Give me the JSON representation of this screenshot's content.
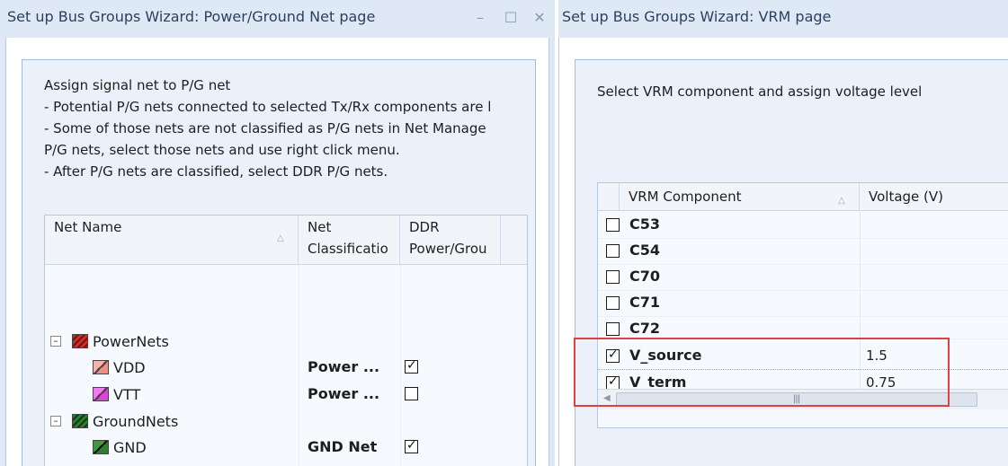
{
  "left_window": {
    "title": "Set up Bus Groups Wizard: Power/Ground Net page",
    "controls": {
      "minimize": "–",
      "maximize": "☐",
      "close": "✕"
    },
    "instructions": [
      "Assign signal net to P/G net",
      "- Potential P/G nets connected to selected Tx/Rx components are l",
      "- Some of those nets are not classified as P/G nets in Net Manage",
      "P/G nets, select those nets and use right click menu.",
      "- After P/G nets are classified, select DDR P/G nets."
    ],
    "columns": {
      "net_name": "Net Name",
      "net_classification_1": "Net",
      "net_classification_2": "Classificatio",
      "ddr_1": "DDR",
      "ddr_2": "Power/Grou"
    },
    "tree": [
      {
        "kind": "group",
        "label": "PowerNets",
        "expander": "–"
      },
      {
        "kind": "net",
        "label": "VDD",
        "classification": "Power ...",
        "ddr_checked": true
      },
      {
        "kind": "net",
        "label": "VTT",
        "classification": "Power ...",
        "ddr_checked": false
      },
      {
        "kind": "group",
        "label": "GroundNets",
        "expander": "–"
      },
      {
        "kind": "net",
        "label": "GND",
        "classification": "GND Net",
        "ddr_checked": true
      }
    ],
    "colors": {
      "powernets_icon": "#c9302c",
      "vdd_icon": "#f08f84",
      "vtt_icon": "#e040e0",
      "groundnets_icon": "#2e7d32",
      "gnd_icon": "#2e7d32"
    }
  },
  "right_window": {
    "title": "Set up Bus Groups Wizard: VRM page",
    "instruction": "Select VRM component and assign voltage level",
    "columns": {
      "component": "VRM Component",
      "voltage": "Voltage (V)"
    },
    "rows": [
      {
        "name": "C53",
        "checked": false,
        "voltage": ""
      },
      {
        "name": "C54",
        "checked": false,
        "voltage": ""
      },
      {
        "name": "C70",
        "checked": false,
        "voltage": ""
      },
      {
        "name": "C71",
        "checked": false,
        "voltage": ""
      },
      {
        "name": "C72",
        "checked": false,
        "voltage": ""
      },
      {
        "name": "V_source",
        "checked": true,
        "voltage": "1.5"
      },
      {
        "name": "V_term",
        "checked": true,
        "voltage": "0.75"
      }
    ],
    "highlight_color": "#e0403f"
  }
}
